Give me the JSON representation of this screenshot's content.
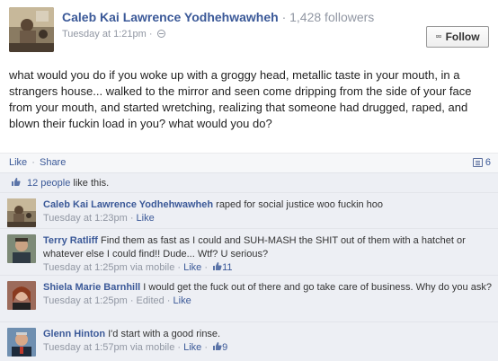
{
  "post": {
    "author": "Caleb Kai Lawrence Yodhehwawheh",
    "separator": "·",
    "followers": "1,428 followers",
    "timestamp": "Tuesday at 1:21pm",
    "time_sep": "·",
    "follow_label": "Follow",
    "body": "what would you do if you woke up with a groggy head, metallic taste in your mouth, in a strangers house... walked to the mirror and seen come dripping from the side of your face from your mouth, and started wretching, realizing that someone had drugged, raped, and blown their fuckin load in you? what would you do?"
  },
  "actions": {
    "like": "Like",
    "dot": "·",
    "share": "Share",
    "comment_count": "6"
  },
  "likes": {
    "people_link": "12 people",
    "suffix": " like this."
  },
  "comments": [
    {
      "author": "Caleb Kai Lawrence Yodhehwawheh",
      "text": "raped for social justice woo fuckin hoo",
      "time": "Tuesday at 1:23pm",
      "sep": " · ",
      "edited": "",
      "like": "Like",
      "likes": ""
    },
    {
      "author": "Terry Ratliff",
      "text": "Find them as fast as I could and SUH-MASH the SHIT out of them with a hatchet or whatever else I could find!! Dude... Wtf? U serious?",
      "time": "Tuesday at 1:25pm via mobile",
      "sep": " · ",
      "edited": "",
      "like": "Like",
      "likes": "11"
    },
    {
      "author": "Shiela Marie Barnhill",
      "text": "I would get the fuck out of there and go take care of business. Why do you ask?",
      "time": "Tuesday at 1:25pm",
      "sep": " · ",
      "edited": "Edited · ",
      "like": "Like",
      "likes": ""
    },
    {
      "author": "Glenn Hinton",
      "text": "I'd start with a good rinse.",
      "time": "Tuesday at 1:57pm via mobile",
      "sep": " · ",
      "edited": "",
      "like": "Like",
      "likes": "9"
    }
  ],
  "colors": {
    "link": "#3b5998",
    "muted": "#9197a3",
    "comment_bg": "#edeff4"
  }
}
